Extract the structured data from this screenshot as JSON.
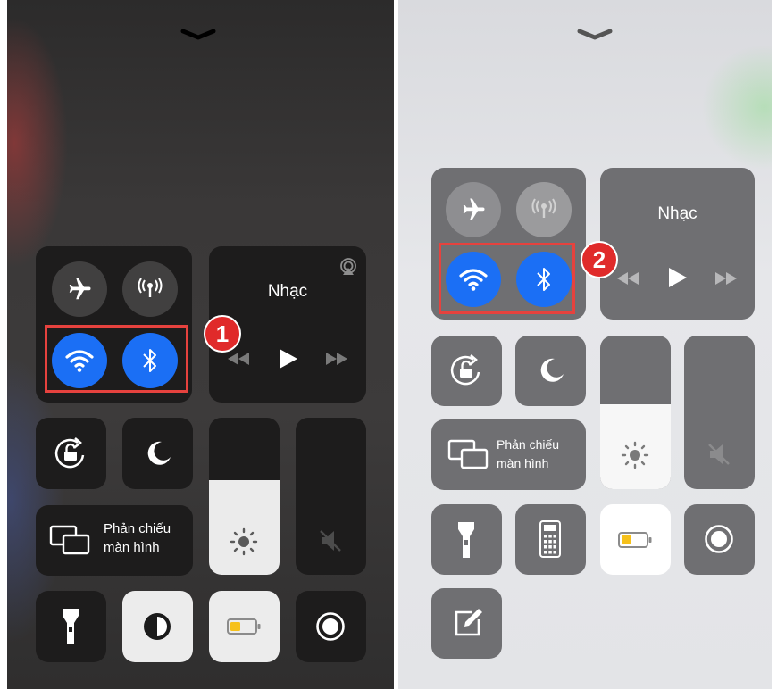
{
  "left": {
    "music_title": "Nhạc",
    "screen_mirroring": [
      "Phản chiếu",
      "màn hình"
    ],
    "callout_number": "1",
    "brightness_level": 0.6,
    "volume_level": 0.0,
    "wifi_enabled": true,
    "bluetooth_enabled": true,
    "airplane_mode_enabled": false,
    "cellular_enabled": false
  },
  "right": {
    "music_title": "Nhạc",
    "screen_mirroring": [
      "Phản chiếu",
      "màn hình"
    ],
    "callout_number": "2",
    "brightness_level": 0.55,
    "volume_level": 0.0,
    "wifi_enabled": true,
    "bluetooth_enabled": true,
    "airplane_mode_enabled": false,
    "cellular_enabled": false
  },
  "colors": {
    "active_blue": "#1b6ff5",
    "highlight_red": "#e6423e",
    "badge_red": "#e02a2a",
    "battery_yellow": "#f6c11b"
  },
  "icons": [
    "chevron-down-icon",
    "airplane-icon",
    "cellular-icon",
    "wifi-icon",
    "bluetooth-icon",
    "airplay-icon",
    "rewind-icon",
    "play-icon",
    "fast-forward-icon",
    "rotation-lock-icon",
    "moon-icon",
    "screen-mirroring-icon",
    "brightness-icon",
    "mute-icon",
    "flashlight-icon",
    "invert-colors-icon",
    "low-power-battery-icon",
    "screen-record-icon",
    "calculator-icon",
    "notes-icon"
  ]
}
